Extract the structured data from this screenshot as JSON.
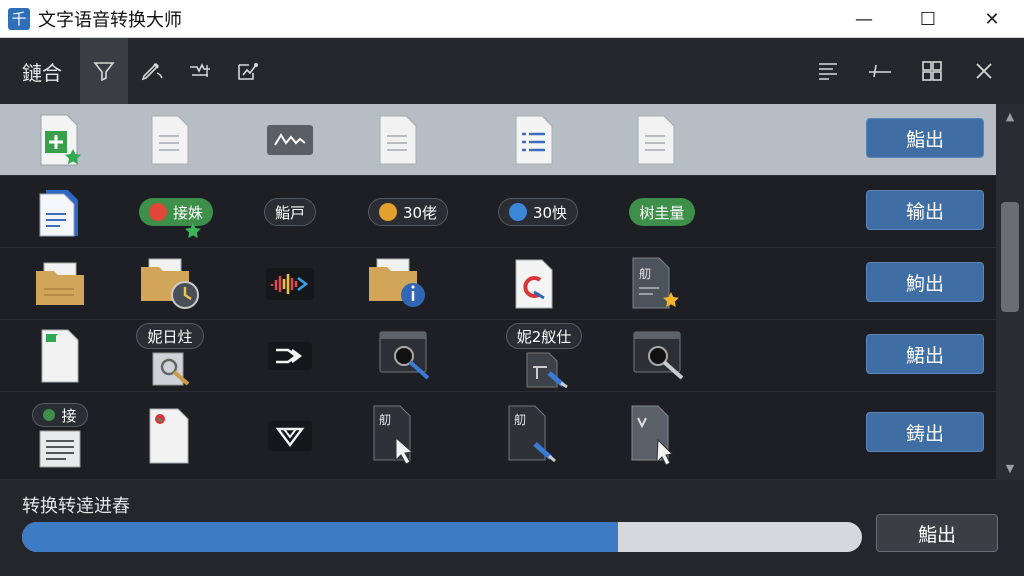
{
  "window": {
    "title": "文字语音转换大师",
    "app_icon_glyph": "千",
    "controls": {
      "minimize": "—",
      "maximize": "☐",
      "close": "✕"
    }
  },
  "toolbar": {
    "label": "鏈合",
    "tool_icons": [
      "funnel-icon",
      "pen-icon",
      "stamp-icon",
      "edit-chart-icon"
    ],
    "right_icons": [
      "align-icon",
      "divider-icon",
      "layout-icon",
      "close-icon"
    ]
  },
  "rows": [
    {
      "selected": true,
      "output_label": "鮨出",
      "cells": [
        {
          "icon": "add-doc-icon"
        },
        {
          "icon": "blank-doc-icon"
        },
        {
          "icon": "waveform-icon"
        },
        {
          "icon": "blank-doc-icon"
        },
        {
          "icon": "list-doc-icon"
        },
        {
          "icon": "blank-doc-icon"
        }
      ]
    },
    {
      "selected": false,
      "output_label": "输出",
      "cells": [
        {
          "icon": "blue-doc-icon"
        },
        {
          "icon": "pill",
          "pill_style": "green",
          "dot_color": "#e0473a",
          "text": "接姝"
        },
        {
          "icon": "pill",
          "pill_style": "dark",
          "dot_color": "",
          "text": "鮨戸"
        },
        {
          "icon": "pill",
          "pill_style": "dark",
          "dot_color": "#e2a12e",
          "text": "30佬"
        },
        {
          "icon": "pill",
          "pill_style": "dark",
          "dot_color": "#3c86d8",
          "text": "30怏"
        },
        {
          "icon": "pill",
          "pill_style": "green",
          "dot_color": "",
          "text": "树圭量"
        }
      ]
    },
    {
      "selected": false,
      "output_label": "鮈出",
      "cells": [
        {
          "icon": "folder-doc-icon"
        },
        {
          "icon": "folder-clock-icon"
        },
        {
          "icon": "color-waveform-icon"
        },
        {
          "icon": "folder-info-icon"
        },
        {
          "icon": "red-logo-doc-icon"
        },
        {
          "icon": "dark-doc-star-icon",
          "text": "舠"
        }
      ]
    },
    {
      "selected": false,
      "output_label": "鮶出",
      "cells": [
        {
          "icon": "green-doc-icon"
        },
        {
          "icon": "search-doc-icon",
          "label": "妮日炷"
        },
        {
          "icon": "play-chevron-icon"
        },
        {
          "icon": "console-search-icon"
        },
        {
          "icon": "dark-doc-pen-icon",
          "label": "妮2舣仕"
        },
        {
          "icon": "console-search-icon"
        }
      ]
    },
    {
      "selected": false,
      "output_label": "鋳出",
      "cells": [
        {
          "icon": "text-doc-icon",
          "label": "接"
        },
        {
          "icon": "red-dot-doc-icon"
        },
        {
          "icon": "triangle-icon"
        },
        {
          "icon": "dark-doc-cursor-icon",
          "text": "舠"
        },
        {
          "icon": "dark-doc-pen-icon",
          "text": "舠"
        },
        {
          "icon": "gray-doc-cursor-icon"
        }
      ]
    }
  ],
  "progress": {
    "label": "转换转逹进舂",
    "fraction": 0.71,
    "button_label": "鮨出"
  },
  "colors": {
    "accent": "#3f6ea5",
    "progress_fill": "#3d7bc4",
    "selected_row": "#b7bdc4",
    "green_pill": "#3e8f4a"
  }
}
